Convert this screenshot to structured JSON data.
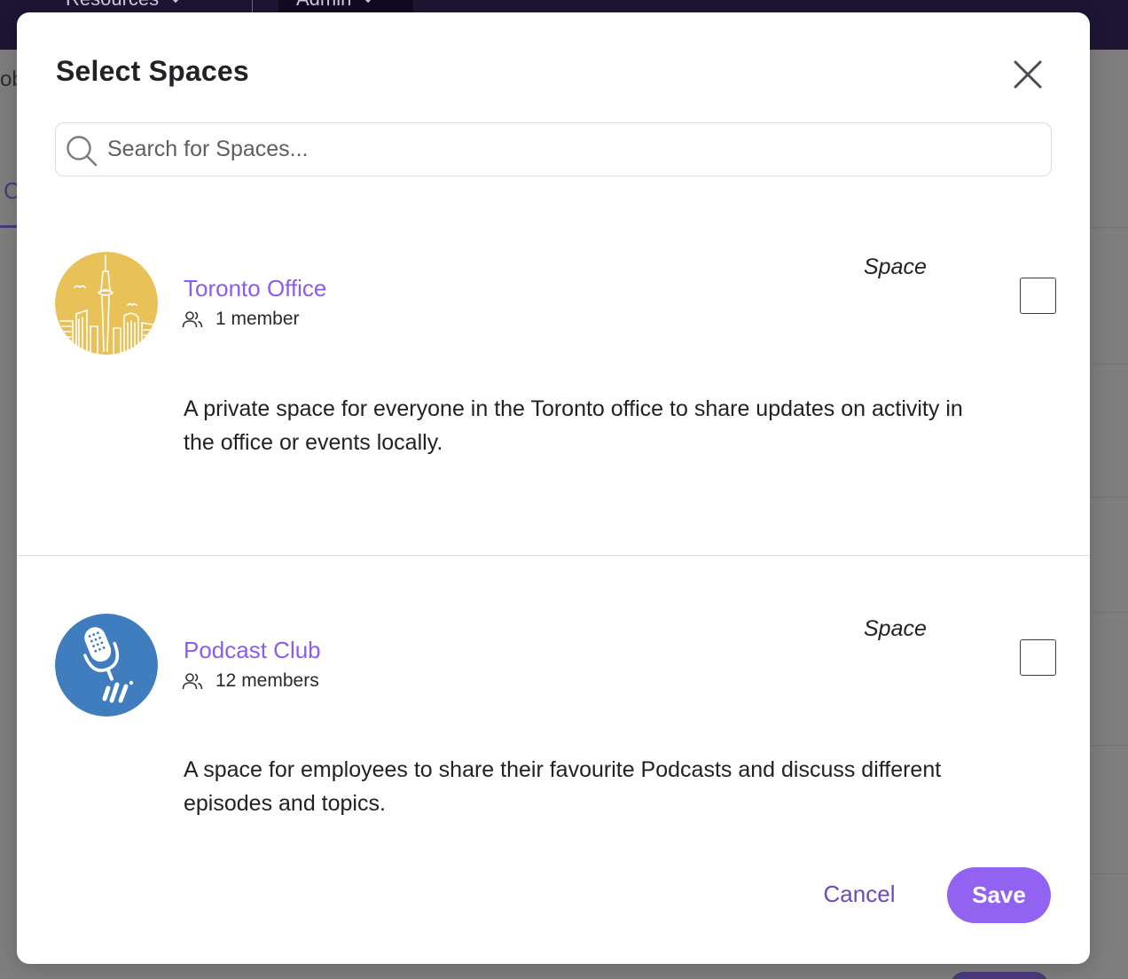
{
  "background": {
    "nav_items": [
      {
        "label": "Resources"
      },
      {
        "label": "Admin"
      }
    ],
    "edge_text": "ob",
    "edge_tab": "C"
  },
  "modal": {
    "title": "Select Spaces",
    "close_icon": "close-icon",
    "search": {
      "placeholder": "Search for Spaces...",
      "value": "",
      "icon": "search-icon"
    },
    "spaces": [
      {
        "name": "Toronto Office",
        "members": "1 member",
        "type": "Space",
        "description": "A private space for everyone in the Toronto office to share updates on activity in the office or events locally.",
        "checked": false,
        "avatar_color": "#E8C158",
        "avatar_icon": "toronto-skyline-icon"
      },
      {
        "name": "Podcast Club",
        "members": "12 members",
        "type": "Space",
        "description": "A space for employees to share their favourite Podcasts and discuss different episodes and topics.",
        "checked": false,
        "avatar_color": "#3F7DBF",
        "avatar_icon": "microphone-icon"
      }
    ],
    "actions": {
      "cancel_label": "Cancel",
      "save_label": "Save"
    }
  },
  "colors": {
    "accent": "#9163F0",
    "link": "#8A5CF0",
    "nav_bg": "#1E1534"
  }
}
